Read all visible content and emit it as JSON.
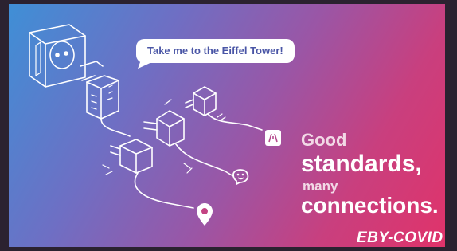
{
  "speech_bubble": {
    "text": "Take me to the Eiffel Tower!"
  },
  "headline": {
    "line1": "Good",
    "line2": "standards,",
    "line3": "many",
    "line4": "connections."
  },
  "logo": {
    "text": "EBY-COVID"
  },
  "colors": {
    "gradient_start": "#3f8fd6",
    "gradient_end": "#e0336a",
    "line_art": "#ffffff",
    "bubble_text": "#4a56a6"
  },
  "icons": [
    "wall-socket-icon",
    "travel-adapter-icon",
    "plug-icon",
    "map-app-icon",
    "waze-app-icon",
    "location-pin-icon"
  ]
}
